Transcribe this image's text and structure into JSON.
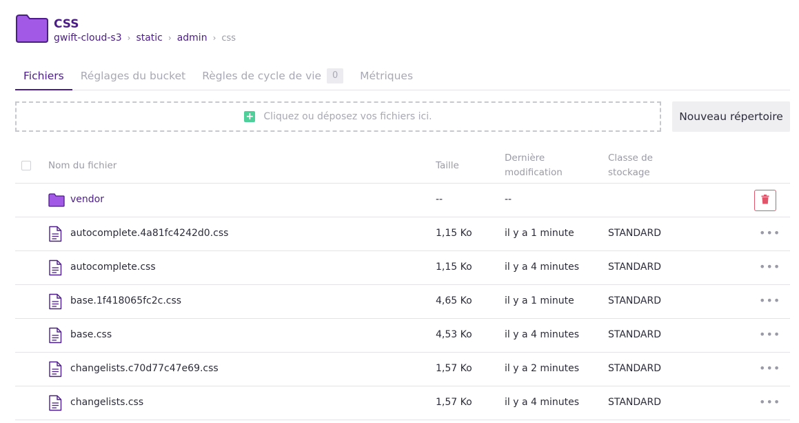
{
  "header": {
    "title": "CSS",
    "breadcrumb": [
      "gwift-cloud-s3",
      "static",
      "admin"
    ],
    "breadcrumb_current": "css",
    "icon": "folder-icon"
  },
  "tabs": [
    {
      "label": "Fichiers",
      "active": true
    },
    {
      "label": "Réglages du bucket",
      "active": false
    },
    {
      "label": "Règles de cycle de vie",
      "count": "0",
      "active": false
    },
    {
      "label": "Métriques",
      "active": false
    }
  ],
  "dropzone": {
    "label": "Cliquez ou déposez vos fichiers ici.",
    "icon": "plus-icon"
  },
  "new_directory_label": "Nouveau répertoire",
  "table": {
    "headers": {
      "name": "Nom du fichier",
      "size": "Taille",
      "modified_line1": "Dernière",
      "modified_line2": "modification",
      "class_line1": "Classe de",
      "class_line2": "stockage"
    },
    "rows": [
      {
        "type": "folder",
        "name": "vendor",
        "size": "--",
        "modified": "--",
        "class": ""
      },
      {
        "type": "file",
        "name": "autocomplete.4a81fc4242d0.css",
        "size": "1,15 Ko",
        "modified": "il y a 1 minute",
        "class": "STANDARD"
      },
      {
        "type": "file",
        "name": "autocomplete.css",
        "size": "1,15 Ko",
        "modified": "il y a 4 minutes",
        "class": "STANDARD"
      },
      {
        "type": "file",
        "name": "base.1f418065fc2c.css",
        "size": "4,65 Ko",
        "modified": "il y a 1 minute",
        "class": "STANDARD"
      },
      {
        "type": "file",
        "name": "base.css",
        "size": "4,53 Ko",
        "modified": "il y a 4 minutes",
        "class": "STANDARD"
      },
      {
        "type": "file",
        "name": "changelists.c70d77c47e69.css",
        "size": "1,57 Ko",
        "modified": "il y a 2 minutes",
        "class": "STANDARD"
      },
      {
        "type": "file",
        "name": "changelists.css",
        "size": "1,57 Ko",
        "modified": "il y a 4 minutes",
        "class": "STANDARD"
      }
    ],
    "more_label": "•••"
  },
  "colors": {
    "accent": "#4b1d86",
    "folder": "#a259e6",
    "add_green": "#4fcf9a",
    "delete_red": "#e0556a"
  }
}
